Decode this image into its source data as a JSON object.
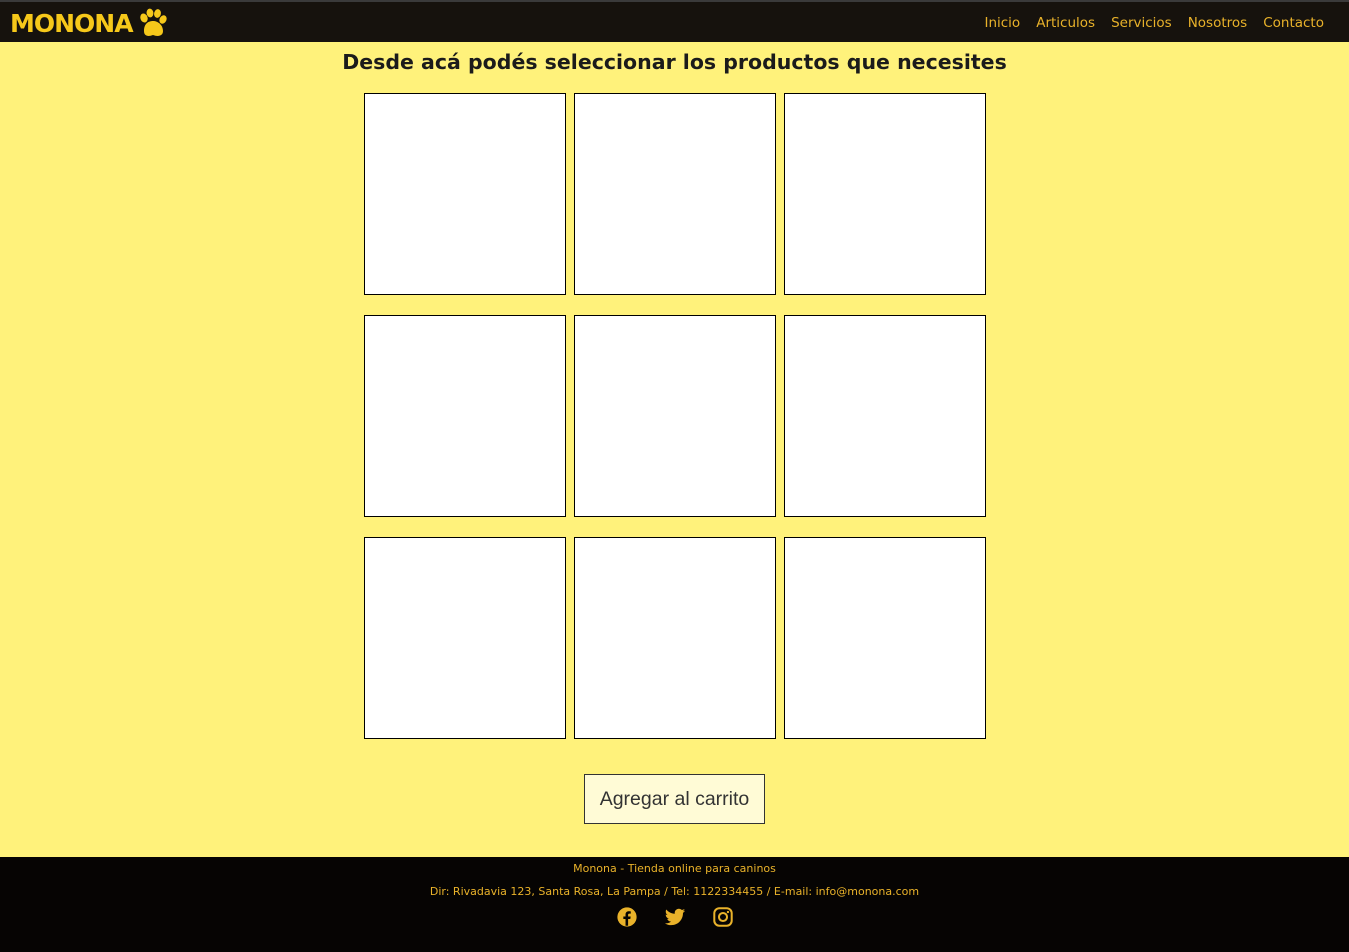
{
  "brand": {
    "name": "MONONA",
    "color": "#f6c81a"
  },
  "nav": {
    "items": [
      {
        "label": "Inicio"
      },
      {
        "label": "Articulos"
      },
      {
        "label": "Servicios"
      },
      {
        "label": "Nosotros"
      },
      {
        "label": "Contacto"
      }
    ]
  },
  "main": {
    "heading": "Desde acá podés seleccionar los productos que necesites",
    "products_count": 9,
    "cart_button_label": "Agregar al carrito",
    "background": "#fff27b"
  },
  "footer": {
    "line1": "Monona - Tienda online para caninos",
    "line2": "Dir: Rivadavia 123, Santa Rosa, La Pampa / Tel: 1122334455 / E-mail: info@monona.com",
    "social": [
      {
        "icon": "facebook-icon"
      },
      {
        "icon": "twitter-icon"
      },
      {
        "icon": "instagram-icon"
      }
    ]
  }
}
